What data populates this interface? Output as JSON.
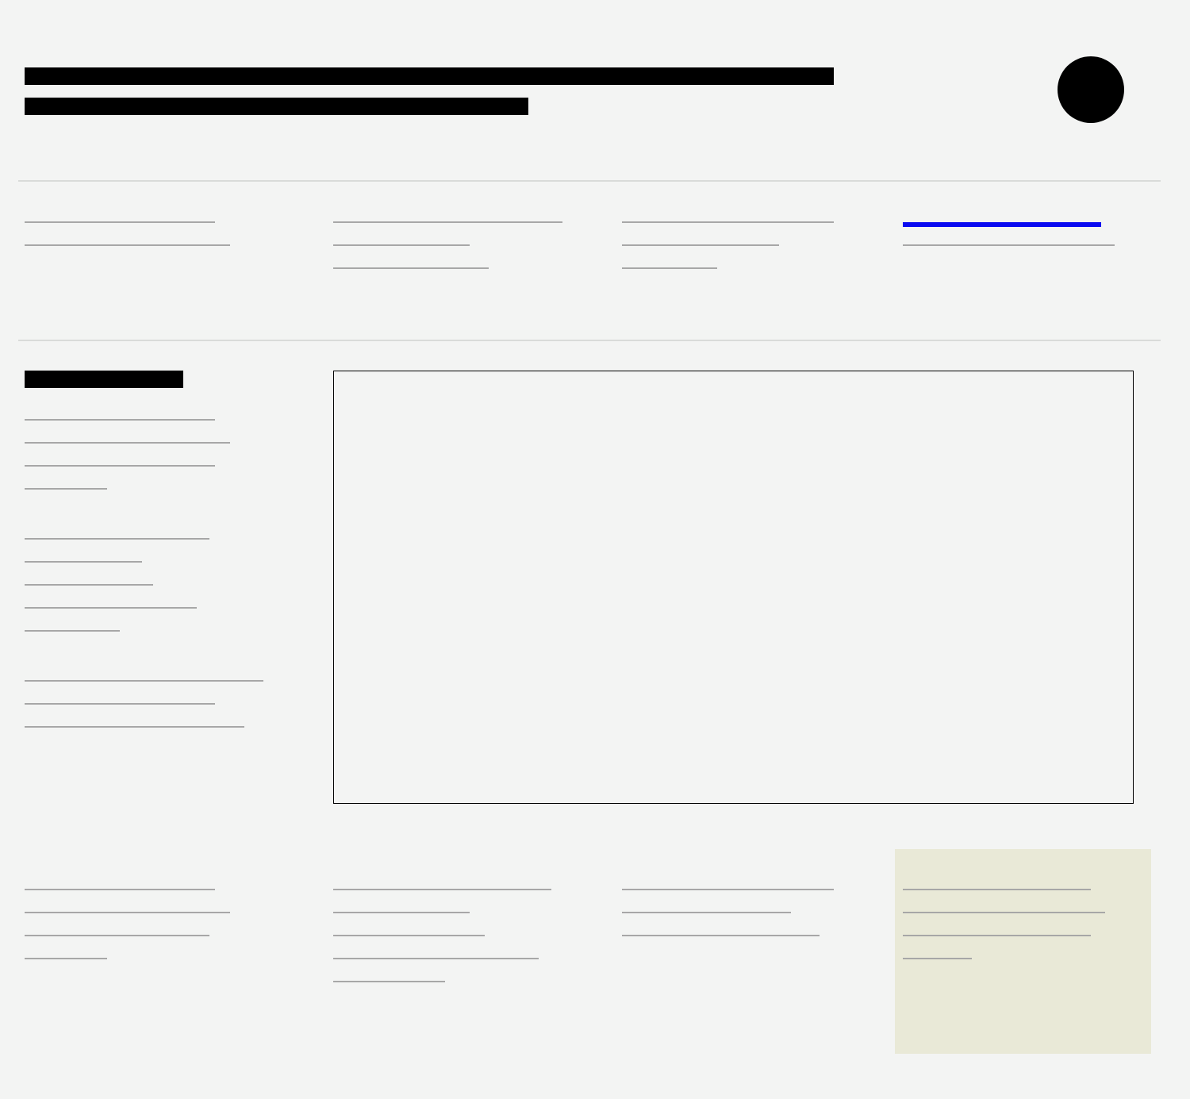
{
  "placeholder_ui": {
    "colors": {
      "background": "#f3f4f3",
      "title_bar": "#000000",
      "text_line": "#a7a7a7",
      "divider": "#d9dbd9",
      "link": "#0a0af0",
      "note_box": "#e9e9d7",
      "frame_border": "#000000"
    }
  }
}
